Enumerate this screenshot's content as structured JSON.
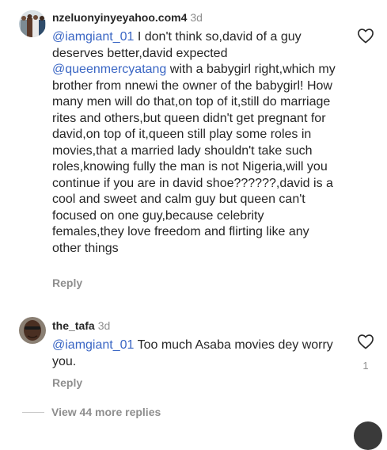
{
  "comments": [
    {
      "username": "nzeluonyinyeyahoo.com4",
      "timestamp": "3d",
      "mention1": "@iamgiant_01",
      "text1": " I don't think so,david of a guy deserves better,david expected ",
      "mention2": "@queenmercyatang",
      "text2": " with a babygirl right,which my brother from nnewi the owner of the babygirl! How many men will do that,on top of it,still do marriage rites and others,but queen didn't get pregnant for david,on top of it,queen still play some roles in movies,that a married lady shouldn't take such roles,knowing fully the man is not Nigeria,will you continue if you are in david shoe??????,david is a cool and sweet and calm guy but queen can't focused on one guy,because celebrity females,they love freedom and flirting like any other things",
      "reply_label": "Reply",
      "icons": {
        "avatar": "avatar-group-photo",
        "like": "heart-outline-icon"
      }
    },
    {
      "username": "the_tafa",
      "timestamp": "3d",
      "mention1": "@iamgiant_01",
      "text1": " Too much Asaba movies dey worry you.",
      "reply_label": "Reply",
      "like_count": "1",
      "icons": {
        "avatar": "avatar-portrait-photo",
        "like": "heart-outline-icon"
      }
    }
  ],
  "view_more": {
    "label": "View 44 more replies"
  },
  "colors": {
    "text": "#262626",
    "muted": "#8e8e8e",
    "mention": "#3a66c4",
    "background": "#ffffff"
  }
}
